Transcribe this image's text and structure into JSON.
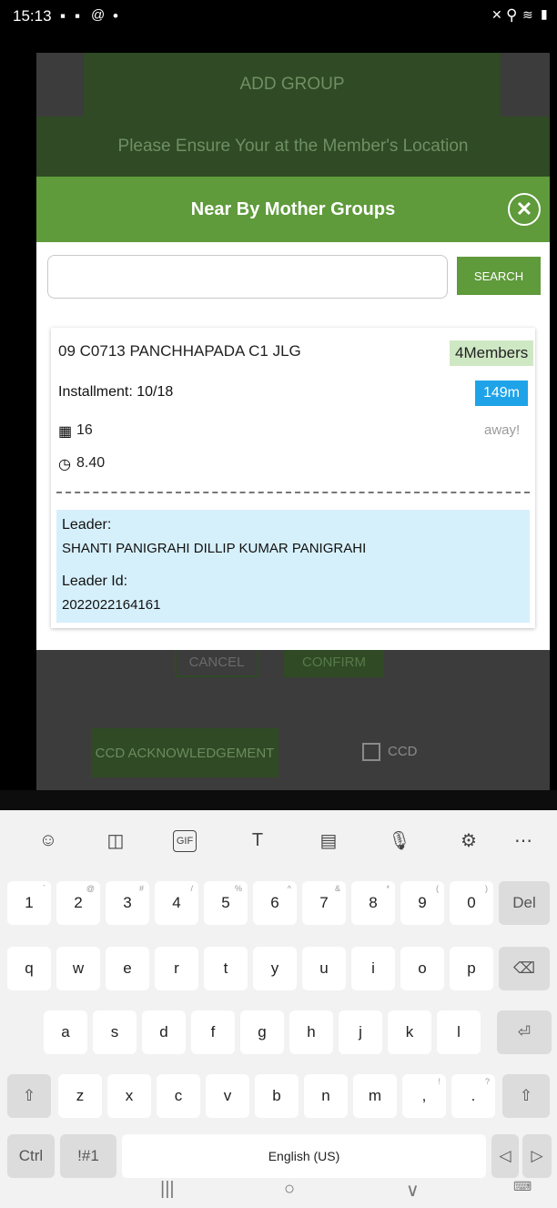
{
  "status_bar": {
    "time": "15:13",
    "left_icons": [
      "video-icon",
      "gallery-icon",
      "at-icon",
      "dot-icon"
    ],
    "right_icons": [
      "mute-icon",
      "location-icon",
      "wifi-icon",
      "signal-icon"
    ]
  },
  "background": {
    "header_title": "ADD GROUP",
    "location_notice": "Please Ensure Your at the Member's Location",
    "cancel_label": "CANCEL",
    "confirm_label": "CONFIRM",
    "ccd_ack_label": "CCD ACKNOWLEDGEMENT",
    "ccd_checkbox_label": "CCD"
  },
  "dialog": {
    "title": "Near By Mother Groups",
    "search_value": "",
    "search_button": "SEARCH",
    "group": {
      "name": "09 C0713 PANCHHAPADA C1 JLG",
      "members": "4Members",
      "installment": "Installment: 10/18",
      "distance": "149m",
      "away": "away!",
      "day": "16",
      "time": "8.40",
      "leader_label": "Leader:",
      "leader_name": "SHANTI PANIGRAHI DILLIP KUMAR PANIGRAHI",
      "leader_id_label": "Leader Id:",
      "leader_id": "2022022164161"
    }
  },
  "keyboard": {
    "number_row": [
      {
        "k": "1",
        "h": "`"
      },
      {
        "k": "2",
        "h": "@"
      },
      {
        "k": "3",
        "h": "#"
      },
      {
        "k": "4",
        "h": "/"
      },
      {
        "k": "5",
        "h": "%"
      },
      {
        "k": "6",
        "h": "^"
      },
      {
        "k": "7",
        "h": "&"
      },
      {
        "k": "8",
        "h": "*"
      },
      {
        "k": "9",
        "h": "("
      },
      {
        "k": "0",
        "h": ")"
      }
    ],
    "del_label": "Del",
    "row1": [
      "q",
      "w",
      "e",
      "r",
      "t",
      "y",
      "u",
      "i",
      "o",
      "p"
    ],
    "row2": [
      "a",
      "s",
      "d",
      "f",
      "g",
      "h",
      "j",
      "k",
      "l"
    ],
    "row3": [
      "z",
      "x",
      "c",
      "v",
      "b",
      "n",
      "m"
    ],
    "comma_key": {
      "k": ",",
      "h": "!"
    },
    "period_key": {
      "k": ".",
      "h": "?"
    },
    "ctrl_label": "Ctrl",
    "symbols_label": "!#1",
    "space_label": "English (US)"
  }
}
